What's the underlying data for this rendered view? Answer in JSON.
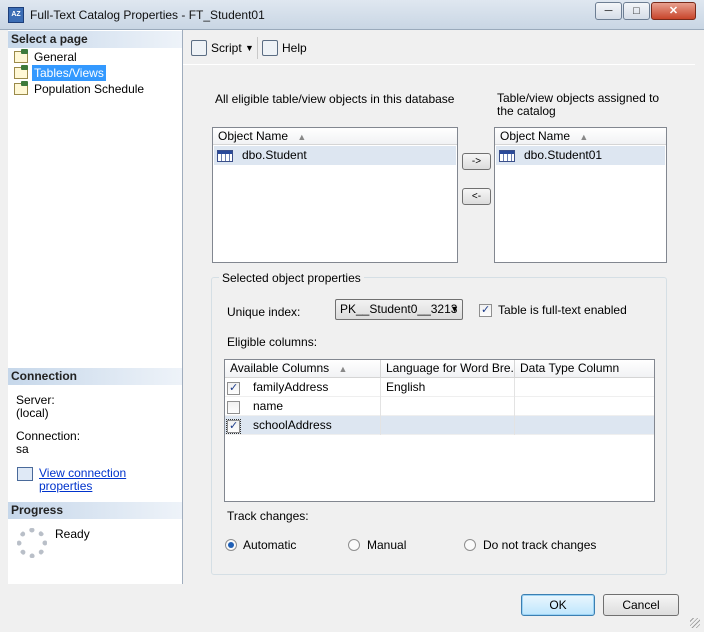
{
  "window": {
    "title": "Full-Text Catalog Properties - FT_Student01",
    "app_icon_text": "AZ",
    "minimize": "─",
    "maximize": "□",
    "close": "✕"
  },
  "left": {
    "select_page_header": "Select a page",
    "pages": [
      {
        "label": "General"
      },
      {
        "label": "Tables/Views"
      },
      {
        "label": "Population Schedule"
      }
    ],
    "connection_header": "Connection",
    "server_label": "Server:",
    "server_value": "(local)",
    "connection_label": "Connection:",
    "connection_value": "sa",
    "view_conn_link": "View connection properties",
    "progress_header": "Progress",
    "progress_status": "Ready"
  },
  "toolbar": {
    "script_label": "Script",
    "help_label": "Help"
  },
  "main": {
    "eligible_label": "All eligible table/view objects in this database",
    "assigned_label": "Table/view objects assigned to the catalog",
    "list_header": "Object Name",
    "eligible_items": [
      "dbo.Student"
    ],
    "assigned_items": [
      "dbo.Student01"
    ],
    "add_arrow": "->",
    "remove_arrow": "<-",
    "selected_props_title": "Selected object properties",
    "unique_index_label": "Unique index:",
    "unique_index_value": "PK__Student0__3213",
    "fulltext_enabled_label": "Table is full-text enabled",
    "eligible_columns_label": "Eligible columns:",
    "columns_headers": [
      "Available Columns",
      "Language for Word Bre...",
      "Data Type Column"
    ],
    "columns_rows": [
      {
        "checked": true,
        "name": "familyAddress",
        "language": "English",
        "datatype": ""
      },
      {
        "checked": false,
        "name": "name",
        "language": "",
        "datatype": ""
      },
      {
        "checked": true,
        "name": "schoolAddress",
        "language": "",
        "datatype": ""
      }
    ],
    "track_changes_label": "Track changes:",
    "track_options": [
      "Automatic",
      "Manual",
      "Do not track changes"
    ],
    "track_selected": "Automatic"
  },
  "buttons": {
    "ok": "OK",
    "cancel": "Cancel"
  }
}
